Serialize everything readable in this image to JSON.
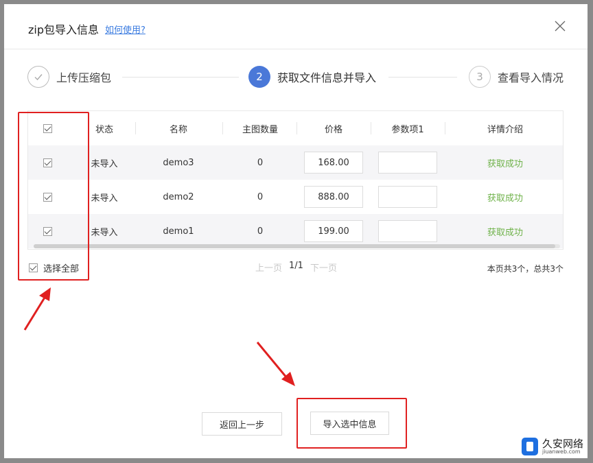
{
  "dialog": {
    "title": "zip包导入信息",
    "help_link": "如何使用?"
  },
  "steps": [
    {
      "index": "",
      "label": "上传压缩包",
      "state": "done"
    },
    {
      "index": "2",
      "label": "获取文件信息并导入",
      "state": "active"
    },
    {
      "index": "3",
      "label": "查看导入情况",
      "state": "todo"
    }
  ],
  "table": {
    "headers": [
      "状态",
      "名称",
      "主图数量",
      "价格",
      "参数项1",
      "详情介绍"
    ],
    "rows": [
      {
        "status": "未导入",
        "name": "demo3",
        "image_count": "0",
        "price": "168.00",
        "param1": "",
        "detail": "获取成功"
      },
      {
        "status": "未导入",
        "name": "demo2",
        "image_count": "0",
        "price": "888.00",
        "param1": "",
        "detail": "获取成功"
      },
      {
        "status": "未导入",
        "name": "demo1",
        "image_count": "0",
        "price": "199.00",
        "param1": "",
        "detail": "获取成功"
      }
    ]
  },
  "footer": {
    "select_all": "选择全部",
    "prev": "上一页",
    "page": "1/1",
    "next": "下一页",
    "page_info": "本页共3个，总共3个"
  },
  "buttons": {
    "back": "返回上一步",
    "import": "导入选中信息"
  },
  "watermark": {
    "name": "久安网络",
    "site": "jiuanweb.com"
  },
  "colors": {
    "accent": "#4a78d8",
    "success": "#6fb24a",
    "link": "#3a7be0",
    "annotation": "#e02020"
  }
}
